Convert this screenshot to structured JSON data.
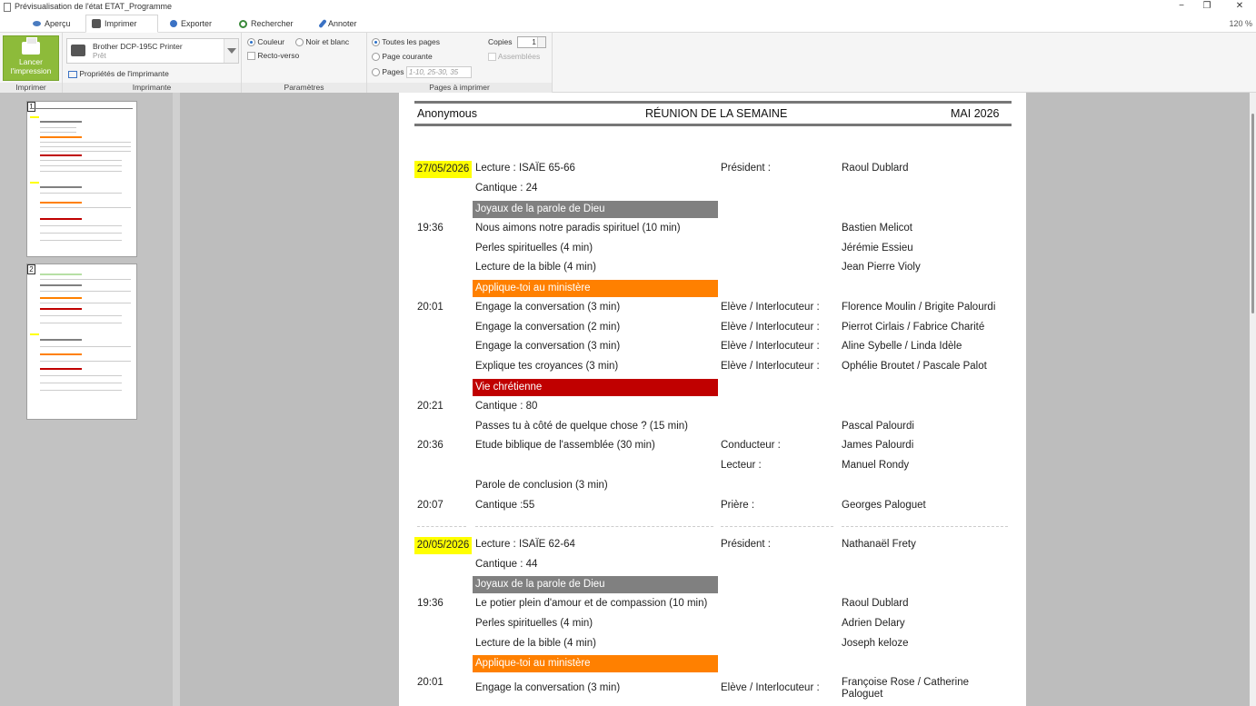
{
  "window": {
    "title": "Prévisualisation de l'état ETAT_Programme",
    "zoom": "120 %",
    "controls": {
      "minimize": "−",
      "maximize": "❐",
      "close": "✕"
    }
  },
  "tabs": [
    {
      "label": "Aperçu",
      "icon": "eye-icon"
    },
    {
      "label": "Imprimer",
      "icon": "printer-icon"
    },
    {
      "label": "Exporter",
      "icon": "share-icon"
    },
    {
      "label": "Rechercher",
      "icon": "search-icon"
    },
    {
      "label": "Annoter",
      "icon": "pen-icon"
    }
  ],
  "ribbon": {
    "print_button": "Lancer l'impression",
    "group_print": "Imprimer",
    "printer_name": "Brother DCP-195C Printer",
    "printer_status": "Prêt",
    "printer_props": "Propriétés de l'imprimante",
    "group_printer": "Imprimante",
    "color": "Couleur",
    "bw": "Noir et blanc",
    "duplex": "Recto-verso",
    "group_params": "Paramètres",
    "all_pages": "Toutes les pages",
    "current_page": "Page courante",
    "pages": "Pages",
    "pages_placeholder": "1-10, 25-30, 35",
    "copies_label": "Copies",
    "copies_value": "1",
    "collated": "Assemblées",
    "group_pages": "Pages à imprimer"
  },
  "thumbnails": [
    {
      "number": "1"
    },
    {
      "number": "2"
    }
  ],
  "report": {
    "header": {
      "left": "Anonymous",
      "center": "RÉUNION DE LA SEMAINE",
      "right": "MAI 2026"
    },
    "meeting1": {
      "date": "27/05/2026",
      "reading": "Lecture : ISAÏE 65-66",
      "president_label": "Président :",
      "president": "Raoul Dublard",
      "song1": "Cantique : 24",
      "band1": "Joyaux de la parole de Dieu",
      "t1": "19:36",
      "talk": "Nous aimons notre paradis spirituel  (10 min)",
      "talk_by": "Bastien Melicot",
      "gems": "Perles spirituelles  (4 min)",
      "gems_by": "Jérémie Essieu",
      "bible": "Lecture de la bible  (4 min)",
      "bible_by": "Jean Pierre Violy",
      "band2": "Applique-toi au ministère",
      "t2": "20:01",
      "m1": "Engage la conversation  (3 min)",
      "m1_role": "Elève / Interlocuteur :",
      "m1_by": "Florence Moulin / Brigite Palourdi",
      "m2": "Engage la conversation  (2 min)",
      "m2_role": "Elève / Interlocuteur :",
      "m2_by": "Pierrot Cirlais / Fabrice Charité",
      "m3": "Engage la conversation  (3 min)",
      "m3_role": "Elève / Interlocuteur :",
      "m3_by": "Aline Sybelle / Linda Idèle",
      "m4": "Explique tes croyances  (3 min)",
      "m4_role": "Elève / Interlocuteur :",
      "m4_by": "Ophélie Broutet / Pascale Palot",
      "band3": "Vie chrétienne",
      "t3": "20:21",
      "song2": "Cantique : 80",
      "c1": "Passes tu à côté de quelque chose ?  (15 min)",
      "c1_by": "Pascal Palourdi",
      "t4": "20:36",
      "study": "Etude biblique de l'assemblée  (30 min)",
      "conductor_label": "Conducteur :",
      "conductor": "James Palourdi",
      "reader_label": "Lecteur :",
      "reader": "Manuel Rondy",
      "conclusion": "Parole de conclusion (3 min)",
      "t5": "20:07",
      "song3": "Cantique :55",
      "prayer_label": "Prière :",
      "prayer": "Georges Paloguet"
    },
    "meeting2": {
      "date": "20/05/2026",
      "reading": "Lecture : ISAÏE 62-64",
      "president_label": "Président :",
      "president": "Nathanaël Frety",
      "song1": "Cantique : 44",
      "band1": "Joyaux de la parole de Dieu",
      "t1": "19:36",
      "talk": "Le potier plein d'amour et de compassion  (10 min)",
      "talk_by": "Raoul Dublard",
      "gems": "Perles spirituelles  (4 min)",
      "gems_by": "Adrien Delary",
      "bible": "Lecture de la bible  (4 min)",
      "bible_by": "Joseph keloze",
      "band2": "Applique-toi au ministère",
      "t2": "20:01",
      "m1": "Engage la conversation  (3 min)",
      "m1_role": "Elève / Interlocuteur :",
      "m1_by_line1": "Françoise Rose / Catherine",
      "m1_by_line2": "Paloguet"
    }
  },
  "colors": {
    "date_highlight": "#ffff00",
    "band_gems": "#808080",
    "band_ministry": "#ff8000",
    "band_christian": "#c00000",
    "print_button": "#8dbb3a"
  }
}
